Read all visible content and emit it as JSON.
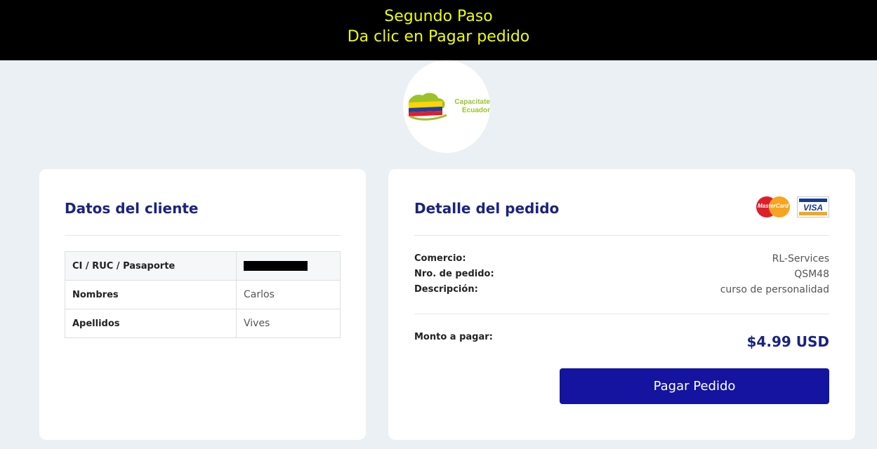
{
  "banner": {
    "line1": "Segundo Paso",
    "line2": "Da clic en Pagar pedido"
  },
  "logo": {
    "line1": "Capacitate",
    "line2": "Ecuador"
  },
  "cliente": {
    "title": "Datos del cliente",
    "rows": [
      {
        "label": "CI / RUC / Pasaporte",
        "value": ""
      },
      {
        "label": "Nombres",
        "value": "Carlos"
      },
      {
        "label": "Apellidos",
        "value": "Vives"
      }
    ]
  },
  "pedido": {
    "title": "Detalle del pedido",
    "payment_icons": [
      "mastercard-icon",
      "visa-icon"
    ],
    "mastercard_label": "MasterCard",
    "visa_label": "VISA",
    "rows": [
      {
        "label": "Comercio:",
        "value": "RL-Services"
      },
      {
        "label": "Nro. de pedido:",
        "value": "QSM48"
      },
      {
        "label": "Descripción:",
        "value": "curso de personalidad"
      }
    ],
    "monto_label": "Monto a pagar:",
    "monto_value": "$4.99 USD",
    "button_label": "Pagar Pedido"
  },
  "colors": {
    "banner_text": "#eeff00",
    "title": "#1a2380",
    "button": "#1414a0",
    "background": "#ebf0f4"
  }
}
